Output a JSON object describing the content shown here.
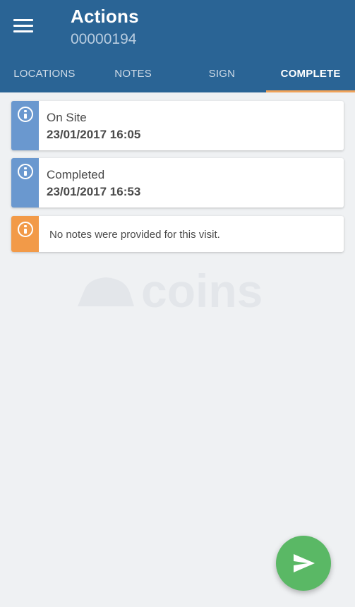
{
  "header": {
    "title": "Actions",
    "subtitle": "00000194"
  },
  "tabs": [
    {
      "label": "LOCATIONS",
      "active": false
    },
    {
      "label": "NOTES",
      "active": false
    },
    {
      "label": "SIGN",
      "active": false
    },
    {
      "label": "COMPLETE",
      "active": true
    }
  ],
  "cards": [
    {
      "label": "On Site",
      "value": "23/01/2017 16:05",
      "icon": "info-icon",
      "color": "#6a98cf"
    },
    {
      "label": "Completed",
      "value": "23/01/2017 16:53",
      "icon": "info-icon",
      "color": "#6a98cf"
    },
    {
      "note": "No notes were provided for this visit.",
      "icon": "info-icon",
      "color": "#f29a48"
    }
  ],
  "watermark": {
    "text": "coins"
  },
  "fab": {
    "icon": "send-icon",
    "color": "#5ab865"
  },
  "colors": {
    "appbar": "#2a6495",
    "tab_indicator": "#f0a35a",
    "background": "#eff1f3"
  }
}
